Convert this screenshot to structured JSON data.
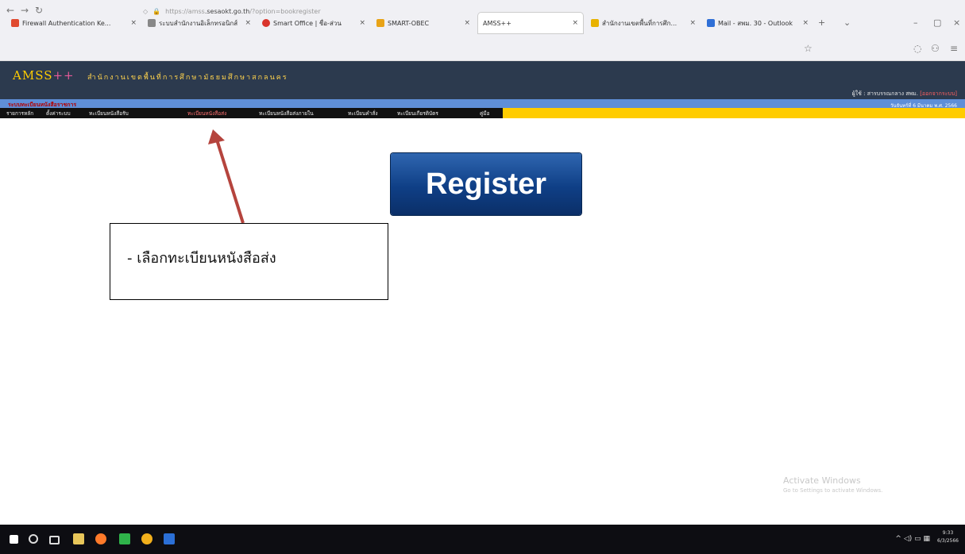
{
  "browser": {
    "tabs": [
      {
        "label": "Firewall Authentication Ke...",
        "color": "#e04a2f"
      },
      {
        "label": "ระบบสำนักงานอิเล็กทรอนิกส์",
        "color": "#888888"
      },
      {
        "label": "Smart Office | ชื่อ-ส่วน",
        "color": "#d9342b"
      },
      {
        "label": "SMART-OBEC",
        "color": "#e8a317"
      },
      {
        "label": "AMSS++",
        "color": "#ffffff"
      },
      {
        "label": "สำนักงานเขตพื้นที่การศึก...",
        "color": "#e8b200"
      },
      {
        "label": "Mail - สพม. 30 - Outlook",
        "color": "#2f6fd6"
      }
    ],
    "new_tab": "+",
    "url_prefix": "https://amss",
    "url_domain": ".sesaokt.go.th",
    "url_path": "/?option=bookregister"
  },
  "amss": {
    "logo_main": "AMSS",
    "logo_plus": "++",
    "org_name": "สำนักงานเขตพื้นที่การศึกษามัธยมศึกษาสกลนคร",
    "user_label": "ผู้ใช้ : สารบรรณกลาง สพม.",
    "user_name": "[ออกจากระบบ]",
    "band_left": "ระบบทะเบียนหนังสือราชการ",
    "band_right": "วันจันทร์ที่ 6 มีนาคม พ.ศ. 2566",
    "menu": [
      "รายการหลัก",
      "ตั้งค่าระบบ",
      "ทะเบียนหนังสือรับ",
      "ทะเบียนหนังสือส่ง",
      "ทะเบียนหนังสือส่งภายใน",
      "ทะเบียนคำสั่ง",
      "ทะเบียนเกียรติบัตร",
      "คู่มือ"
    ]
  },
  "main": {
    "register_label": "Register"
  },
  "annotation": {
    "text": "-  เลือกทะเบียนหนังสือส่ง"
  },
  "watermark": {
    "title": "Activate Windows",
    "subtitle": "Go to Settings to activate Windows."
  },
  "taskbar": {
    "time": "9:33",
    "date": "6/3/2566"
  },
  "colors": {
    "header_bg": "#2c3a4e",
    "logo": "#ffcc00",
    "band": "#5f8fd8",
    "menu_bg": "#111111",
    "menu_accent": "#ffcc00",
    "register_bg": "#0f3f86",
    "arrow": "#b5443d"
  }
}
